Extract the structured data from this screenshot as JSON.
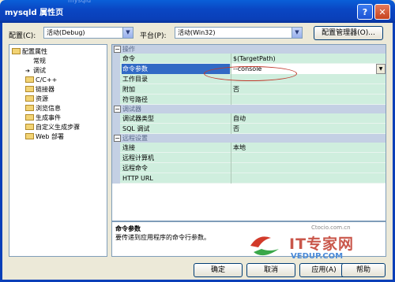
{
  "window": {
    "title": "mysqld 属性页",
    "ghost_text": "mysqld"
  },
  "toolbar": {
    "config_label": "配置(C):",
    "config_value": "活动(Debug)",
    "platform_label": "平台(P):",
    "platform_value": "活动(Win32)",
    "config_manager_label": "配置管理器(O)..."
  },
  "tree": {
    "items": [
      {
        "label": "配置属性",
        "kind": "root"
      },
      {
        "label": "常规",
        "kind": "leaf"
      },
      {
        "label": "调试",
        "kind": "selected-leaf"
      },
      {
        "label": "C/C++",
        "kind": "folder"
      },
      {
        "label": "链接器",
        "kind": "folder"
      },
      {
        "label": "资源",
        "kind": "folder"
      },
      {
        "label": "浏览信息",
        "kind": "folder"
      },
      {
        "label": "生成事件",
        "kind": "folder"
      },
      {
        "label": "自定义生成步骤",
        "kind": "folder"
      },
      {
        "label": "Web 部署",
        "kind": "folder"
      }
    ]
  },
  "grid": {
    "cat1": "操作",
    "cat2": "调试器",
    "cat3": "远程设置",
    "rows": [
      {
        "name": "命令",
        "value": "$(TargetPath)"
      },
      {
        "name": "命令参数",
        "value": "--console"
      },
      {
        "name": "工作目录",
        "value": ""
      },
      {
        "name": "附加",
        "value": "否"
      },
      {
        "name": "符号路径",
        "value": ""
      },
      {
        "name": "调试器类型",
        "value": "自动"
      },
      {
        "name": "SQL 调试",
        "value": "否"
      },
      {
        "name": "连接",
        "value": "本地"
      },
      {
        "name": "远程计算机",
        "value": ""
      },
      {
        "name": "远程命令",
        "value": ""
      },
      {
        "name": "HTTP URL",
        "value": ""
      }
    ]
  },
  "description": {
    "title": "命令参数",
    "text": "要传递到应用程序的命令行参数。"
  },
  "buttons": {
    "ok": "确定",
    "cancel": "取消",
    "apply": "应用(A)",
    "help": "帮助"
  },
  "watermark": {
    "brand": "IT专家网",
    "sub": "Ctocio.com.cn",
    "url": "VEDUP.COM"
  },
  "colors": {
    "title_bar": "#0a47c4",
    "row_background": "#cfeede",
    "selection": "#316ac5",
    "annotation": "#c0392b"
  }
}
